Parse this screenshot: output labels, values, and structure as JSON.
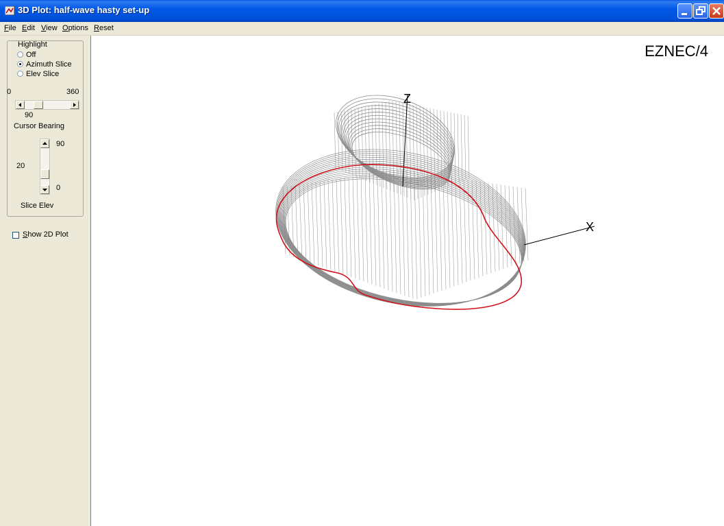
{
  "window": {
    "title": "3D Plot: half-wave hasty set-up"
  },
  "menu": [
    {
      "label": "File",
      "accel_index": 0
    },
    {
      "label": "Edit",
      "accel_index": 0
    },
    {
      "label": "View",
      "accel_index": 0
    },
    {
      "label": "Options",
      "accel_index": 0
    },
    {
      "label": "Reset",
      "accel_index": 0
    }
  ],
  "highlight": {
    "group_label": "Highlight",
    "options": [
      {
        "label": "Off",
        "selected": false
      },
      {
        "label": "Azimuth Slice",
        "selected": true
      },
      {
        "label": "Elev Slice",
        "selected": false
      }
    ]
  },
  "cursor_bearing": {
    "min_label": "0",
    "max_label": "360",
    "value": "90",
    "value_numeric": 90,
    "label": "Cursor Bearing"
  },
  "slice_elev": {
    "max_label": "90",
    "min_label": "0",
    "value": "20",
    "value_numeric": 20,
    "label": "Slice Elev"
  },
  "show_2d_plot": {
    "label": "Show 2D Plot",
    "checked": false
  },
  "plot": {
    "brand": "EZNEC/4",
    "axis_z_label": "Z",
    "axis_x_label": "X",
    "mesh_color": "#8c8c8c",
    "slice_color": "#d0101a"
  }
}
